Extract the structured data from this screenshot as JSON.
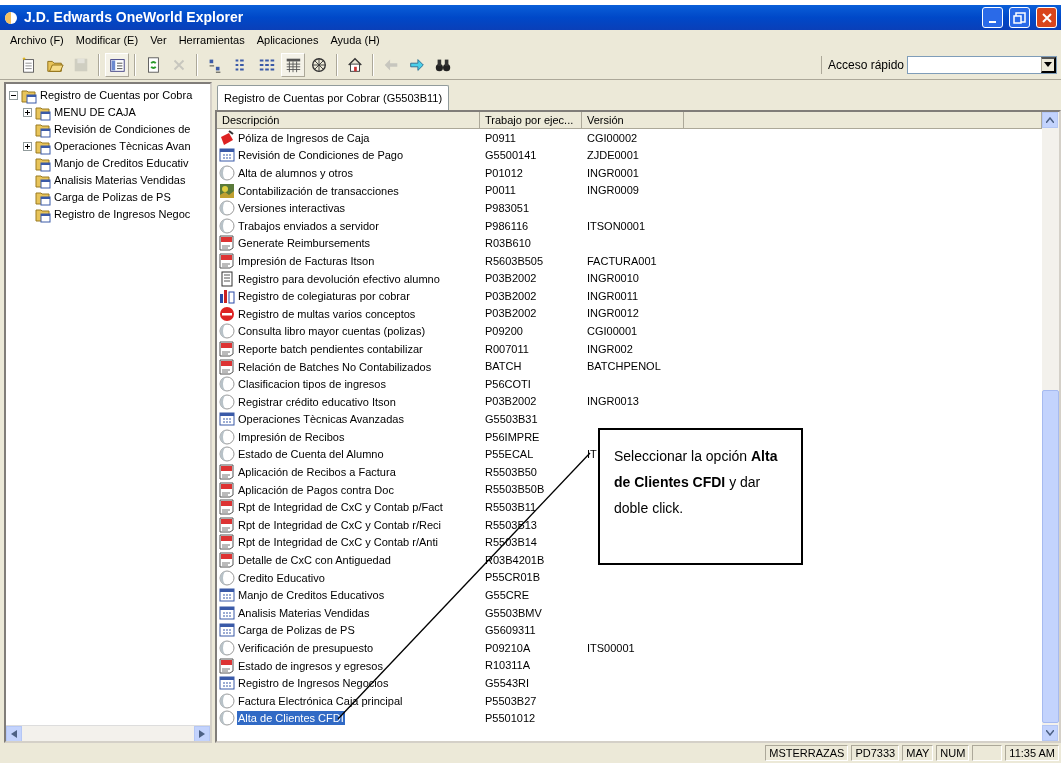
{
  "window": {
    "title": "J.D. Edwards OneWorld Explorer"
  },
  "menu": [
    "Archivo (F)",
    "Modificar (E)",
    "Ver",
    "Herramientas",
    "Aplicaciones",
    "Ayuda (H)"
  ],
  "toolbar": [
    {
      "kind": "new",
      "disabled": false,
      "pressed": false
    },
    {
      "kind": "open",
      "disabled": false,
      "pressed": false
    },
    {
      "kind": "save",
      "disabled": true,
      "pressed": false
    },
    {
      "kind": "sep"
    },
    {
      "kind": "pane",
      "disabled": false,
      "pressed": true
    },
    {
      "kind": "sep"
    },
    {
      "kind": "refresh",
      "disabled": false,
      "pressed": false
    },
    {
      "kind": "delete",
      "disabled": true,
      "pressed": false
    },
    {
      "kind": "sep"
    },
    {
      "kind": "large",
      "disabled": false,
      "pressed": false
    },
    {
      "kind": "small",
      "disabled": false,
      "pressed": false
    },
    {
      "kind": "list",
      "disabled": false,
      "pressed": false
    },
    {
      "kind": "details",
      "disabled": false,
      "pressed": true
    },
    {
      "kind": "web",
      "disabled": false,
      "pressed": false
    },
    {
      "kind": "sep"
    },
    {
      "kind": "home",
      "disabled": false,
      "pressed": false
    },
    {
      "kind": "sep"
    },
    {
      "kind": "back",
      "disabled": true,
      "pressed": false
    },
    {
      "kind": "forward",
      "disabled": false,
      "pressed": false
    },
    {
      "kind": "find",
      "disabled": false,
      "pressed": false
    }
  ],
  "quick_access": {
    "label": "Acceso rápido"
  },
  "tree": [
    {
      "label": "Registro de Cuentas por Cobra",
      "expanded": true,
      "children": [
        {
          "label": "MENU DE CAJA",
          "expanded": false
        },
        {
          "label": "Revisión de Condiciones de"
        },
        {
          "label": "Operaciones Tècnicas Avan",
          "expanded": false
        },
        {
          "label": "Manjo de Creditos Educativ"
        },
        {
          "label": "Analisis Materias Vendidas"
        },
        {
          "label": "Carga de Polizas de PS"
        },
        {
          "label": "Registro de Ingresos Negoc"
        }
      ]
    }
  ],
  "tabs": [
    {
      "label": "Registro de Cuentas por Cobrar (G5503B11)",
      "selected": true
    }
  ],
  "table": {
    "columns": [
      "Descripción",
      "Trabajo por ejec...",
      "Versión"
    ],
    "rows": [
      {
        "kind": "stamp",
        "description": "Póliza de Ingresos de Caja",
        "job": "P0911",
        "version": "CGI00002",
        "selected": false
      },
      {
        "kind": "menu",
        "description": "Revisión de Condiciones de Pago",
        "job": "G5500141",
        "version": "ZJDE0001",
        "selected": false
      },
      {
        "kind": "program",
        "description": "Alta de alumnos  y otros",
        "job": "P01012",
        "version": "INGR0001",
        "selected": false
      },
      {
        "kind": "image",
        "description": "Contabilización de transacciones",
        "job": "P0011",
        "version": "INGR0009",
        "selected": false
      },
      {
        "kind": "program",
        "description": "Versiones interactivas",
        "job": "P983051",
        "version": "",
        "selected": false
      },
      {
        "kind": "program",
        "description": "Trabajos enviados a servidor",
        "job": "P986116",
        "version": "ITSON0001",
        "selected": false
      },
      {
        "kind": "report",
        "description": "Generate Reimbursements",
        "job": "R03B610",
        "version": "",
        "selected": false
      },
      {
        "kind": "report",
        "description": "Impresión de Facturas Itson",
        "job": "R5603B505",
        "version": "FACTURA001",
        "selected": false
      },
      {
        "kind": "document",
        "description": "Registro para devolución efectivo alumno",
        "job": "P03B2002",
        "version": "INGR0010",
        "selected": false
      },
      {
        "kind": "chart",
        "description": "Registro de colegiaturas por cobrar",
        "job": "P03B2002",
        "version": "INGR0011",
        "selected": false
      },
      {
        "kind": "stop",
        "description": "Registro de multas varios conceptos",
        "job": "P03B2002",
        "version": "INGR0012",
        "selected": false
      },
      {
        "kind": "program",
        "description": "Consulta libro mayor cuentas (polizas)",
        "job": "P09200",
        "version": "CGI00001",
        "selected": false
      },
      {
        "kind": "report",
        "description": "Reporte batch pendientes contabilizar",
        "job": "R007011",
        "version": "INGR002",
        "selected": false
      },
      {
        "kind": "report",
        "description": "Relación de Batches No Contabilizados",
        "job": "BATCH",
        "version": "BATCHPENOL",
        "selected": false
      },
      {
        "kind": "program",
        "description": "Clasificacion tipos de ingresos",
        "job": "P56COTI",
        "version": "",
        "selected": false
      },
      {
        "kind": "program",
        "description": "Registrar crédito educativo Itson",
        "job": "P03B2002",
        "version": "INGR0013",
        "selected": false
      },
      {
        "kind": "menu",
        "description": "Operaciones Tècnicas Avanzadas",
        "job": "G5503B31",
        "version": "",
        "selected": false
      },
      {
        "kind": "program",
        "description": "Impresión de Recibos",
        "job": "P56IMPRE",
        "version": "",
        "selected": false
      },
      {
        "kind": "program",
        "description": "Estado de Cuenta del Alumno",
        "job": "P55ECAL",
        "version": "IT",
        "selected": false
      },
      {
        "kind": "report",
        "description": "Aplicación de Recibos a Factura",
        "job": "R5503B50",
        "version": "",
        "selected": false
      },
      {
        "kind": "report",
        "description": "Aplicación de Pagos contra Doc",
        "job": "R5503B50B",
        "version": "",
        "selected": false
      },
      {
        "kind": "report",
        "description": "Rpt de Integridad de CxC y Contab p/Fact",
        "job": "R5503B11",
        "version": "",
        "selected": false
      },
      {
        "kind": "report",
        "description": "Rpt de Integridad de CxC y Contab r/Reci",
        "job": "R5503B13",
        "version": "",
        "selected": false
      },
      {
        "kind": "report",
        "description": "Rpt de Integridad de CxC y Contab r/Anti",
        "job": "R5503B14",
        "version": "",
        "selected": false
      },
      {
        "kind": "report",
        "description": "Detalle de CxC con Antiguedad",
        "job": "R03B4201B",
        "version": "",
        "selected": false
      },
      {
        "kind": "program",
        "description": "Credito Educativo",
        "job": "P55CR01B",
        "version": "",
        "selected": false
      },
      {
        "kind": "menu",
        "description": "Manjo de Creditos Educativos",
        "job": "G55CRE",
        "version": "",
        "selected": false
      },
      {
        "kind": "menu",
        "description": "Analisis Materias Vendidas",
        "job": "G5503BMV",
        "version": "",
        "selected": false
      },
      {
        "kind": "menu",
        "description": "Carga de Polizas de PS",
        "job": "G5609311",
        "version": "",
        "selected": false
      },
      {
        "kind": "program",
        "description": "Verificación de presupuesto",
        "job": "P09210A",
        "version": "ITS00001",
        "selected": false
      },
      {
        "kind": "report",
        "description": "Estado de ingresos y egresos",
        "job": "R10311A",
        "version": "",
        "selected": false
      },
      {
        "kind": "menu",
        "description": "Registro de Ingresos Negocios",
        "job": "G5543RI",
        "version": "",
        "selected": false
      },
      {
        "kind": "program",
        "description": "Factura Electrónica Caja principal",
        "job": "P5503B27",
        "version": "",
        "selected": false
      },
      {
        "kind": "program",
        "description": "Alta de Clientes CFDI",
        "job": "P5501012",
        "version": "",
        "selected": true
      }
    ]
  },
  "callout": {
    "text": "Seleccionar la opción **Alta de Clientes CFDI**  y dar doble click."
  },
  "status_bar": [
    "MSTERRAZAS",
    "PD7333",
    "MAY",
    "NUM",
    "11:35 AM"
  ]
}
